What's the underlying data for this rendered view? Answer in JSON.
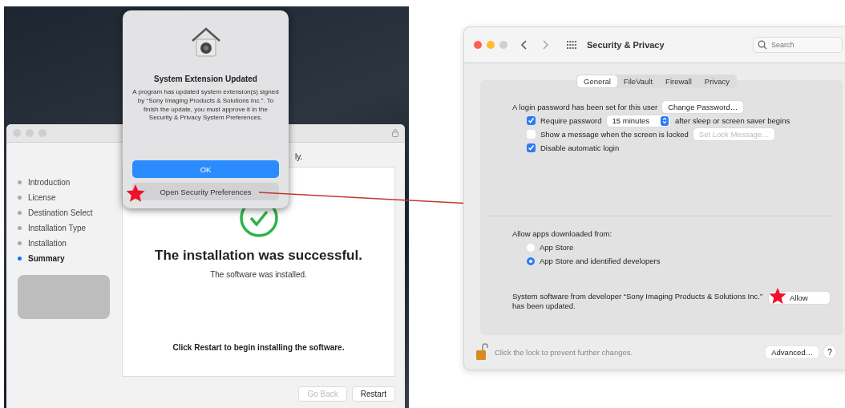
{
  "installer": {
    "dialog": {
      "title": "System Extension Updated",
      "message": "A program has updated system extension(s) signed by “Sony Imaging Products & Solutions Inc.”. To finish the update, you must approve it in the Security & Privacy System Preferences.",
      "buttons": [
        {
          "label": "OK",
          "kind": "primary"
        },
        {
          "label": "Open Security Preferences",
          "kind": "secondary"
        }
      ]
    },
    "steps": [
      {
        "label": "Introduction",
        "selected": false
      },
      {
        "label": "License",
        "selected": false
      },
      {
        "label": "Destination Select",
        "selected": false
      },
      {
        "label": "Installation Type",
        "selected": false
      },
      {
        "label": "Installation",
        "selected": false
      },
      {
        "label": "Summary",
        "selected": true
      }
    ],
    "subtitle_fragment": "ly.",
    "heading": "The installation was successful.",
    "subheading": "The software was installed.",
    "note": "Click Restart to begin installing the software.",
    "buttons": [
      {
        "label": "Go Back",
        "disabled": true
      },
      {
        "label": "Restart",
        "disabled": false
      }
    ]
  },
  "preferences": {
    "window": {
      "title": "Security & Privacy"
    },
    "search": {
      "placeholder": "Search"
    },
    "tabs": [
      {
        "label": "General",
        "selected": true
      },
      {
        "label": "FileVault",
        "selected": false
      },
      {
        "label": "Firewall",
        "selected": false
      },
      {
        "label": "Privacy",
        "selected": false
      }
    ],
    "login_text": "A login password has been set for this user",
    "change_password": "Change Password…",
    "options": [
      {
        "kind": "select",
        "label": "Require password",
        "checked": true,
        "select": "15 minutes",
        "suffix": "after sleep or screen saver begins"
      },
      {
        "kind": "button",
        "label": "Show a message when the screen is locked",
        "checked": false,
        "button": "Set Lock Message…"
      },
      {
        "kind": "plain",
        "label": "Disable automatic login",
        "checked": true
      }
    ],
    "allow_apps": {
      "label": "Allow apps downloaded from:",
      "options": [
        {
          "label": "App Store",
          "selected": false
        },
        {
          "label": "App Store and identified developers",
          "selected": true
        }
      ]
    },
    "system_software": {
      "message": "System software from developer “Sony Imaging Products & Solutions Inc.” has been updated.",
      "button": "Allow"
    },
    "lock_text": "Click the lock to prevent further changes.",
    "advanced": "Advanced…",
    "help": "?"
  }
}
